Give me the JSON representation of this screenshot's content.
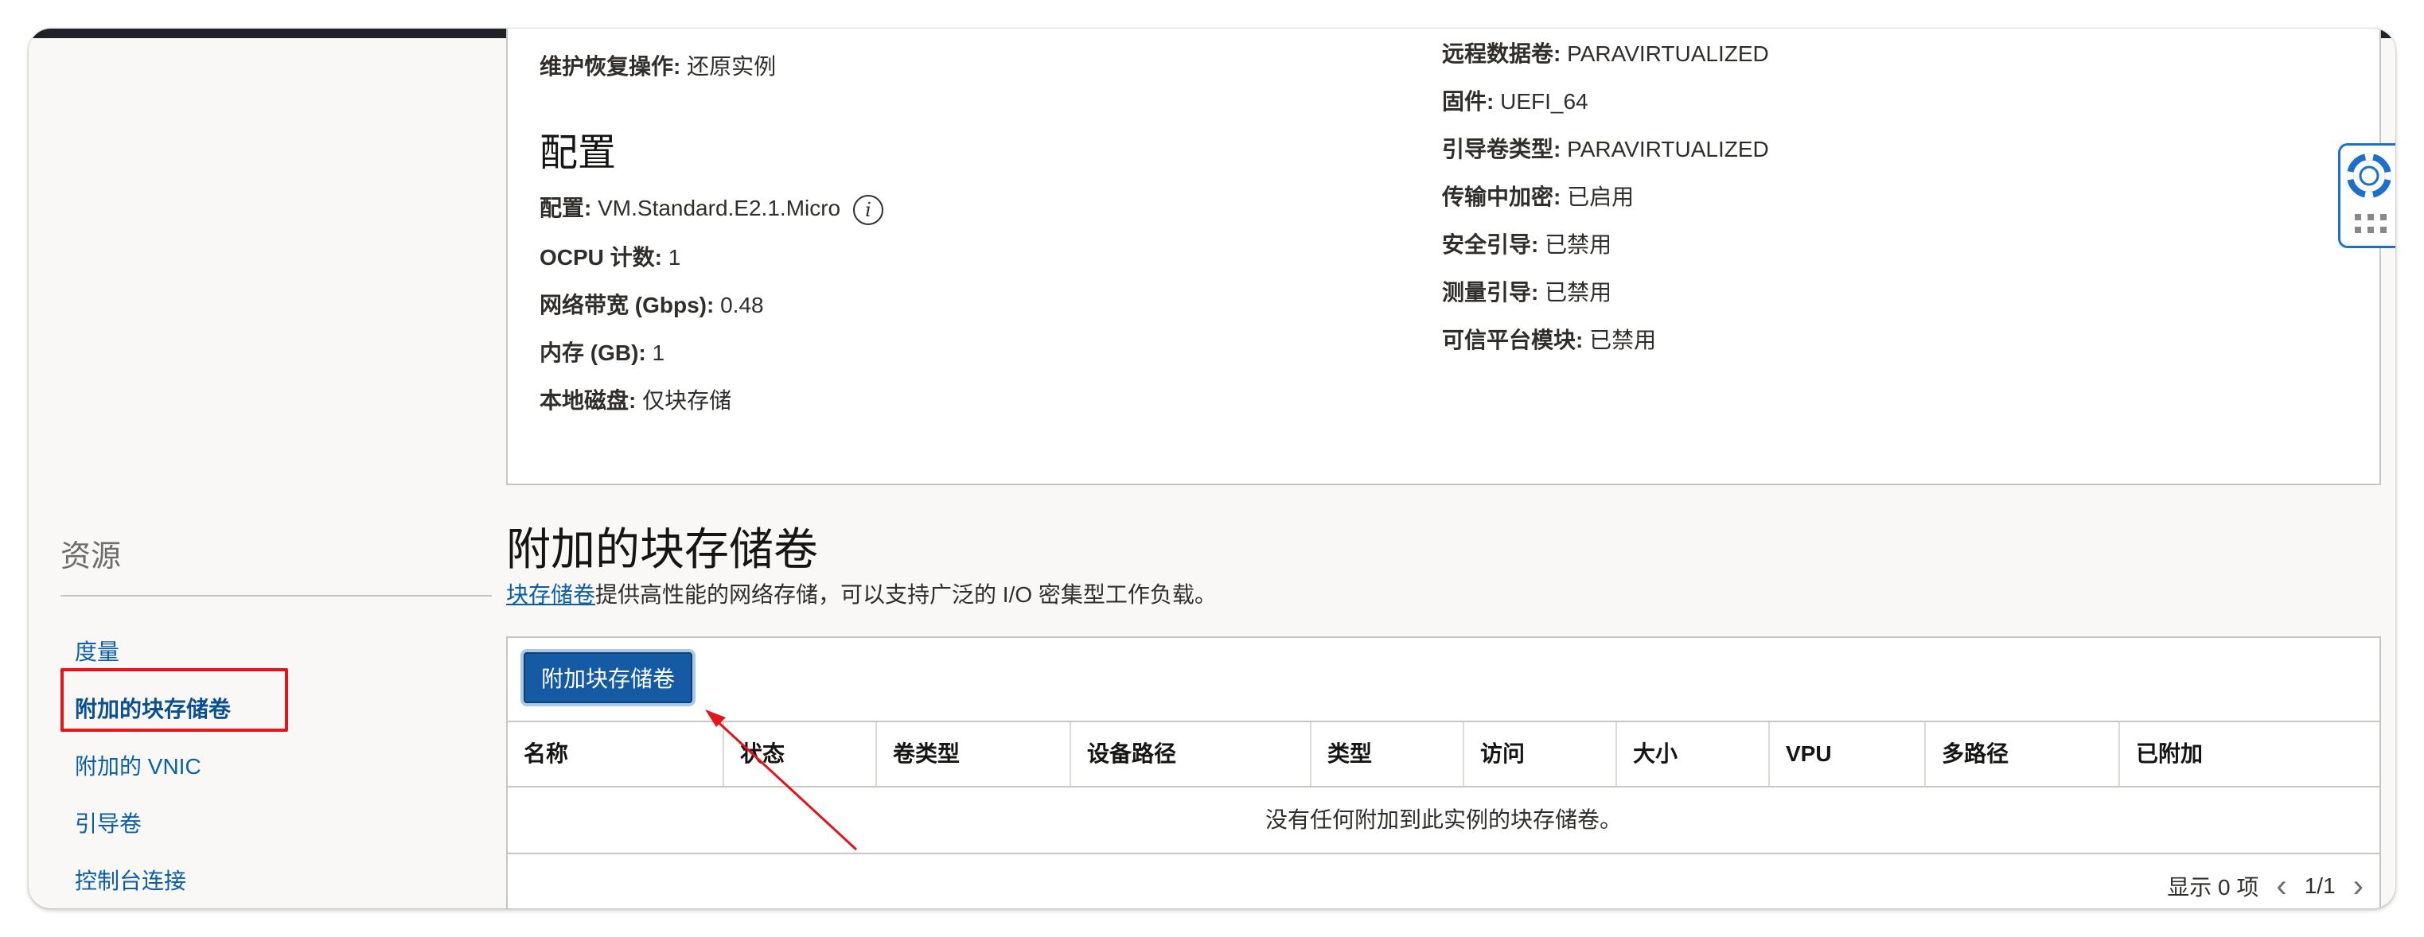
{
  "config_details": {
    "restore_action": {
      "key": "维护恢复操作:",
      "value": "还原实例"
    },
    "section_title": "配置",
    "shape": {
      "key": "配置:",
      "value": "VM.Standard.E2.1.Micro"
    },
    "ocpu": {
      "key": "OCPU 计数:",
      "value": "1"
    },
    "bandwidth": {
      "key": "网络带宽 (Gbps):",
      "value": "0.48"
    },
    "memory": {
      "key": "内存 (GB):",
      "value": "1"
    },
    "local_disk": {
      "key": "本地磁盘:",
      "value": "仅块存储"
    },
    "remote_data_volume": {
      "key": "远程数据卷:",
      "value": "PARAVIRTUALIZED"
    },
    "firmware": {
      "key": "固件:",
      "value": "UEFI_64"
    },
    "boot_volume_type": {
      "key": "引导卷类型:",
      "value": "PARAVIRTUALIZED"
    },
    "in_transit_encryption": {
      "key": "传输中加密:",
      "value": "已启用"
    },
    "secure_boot": {
      "key": "安全引导:",
      "value": "已禁用"
    },
    "measured_boot": {
      "key": "测量引导:",
      "value": "已禁用"
    },
    "trusted_platform_module": {
      "key": "可信平台模块:",
      "value": "已禁用"
    }
  },
  "sidebar": {
    "title": "资源",
    "items": [
      {
        "label": "度量"
      },
      {
        "label": "附加的块存储卷"
      },
      {
        "label": "附加的 VNIC"
      },
      {
        "label": "引导卷"
      },
      {
        "label": "控制台连接"
      }
    ]
  },
  "block_volumes": {
    "title": "附加的块存储卷",
    "desc_link": "块存储卷",
    "desc_text": "提供高性能的网络存储，可以支持广泛的 I/O 密集型工作负载。",
    "attach_button": "附加块存储卷",
    "columns": [
      "名称",
      "状态",
      "卷类型",
      "设备路径",
      "类型",
      "访问",
      "大小",
      "VPU",
      "多路径",
      "已附加"
    ],
    "empty_message": "没有任何附加到此实例的块存储卷。",
    "pager": {
      "count_label": "显示 0 项",
      "page": "1/1"
    }
  },
  "icons": {
    "info": "info-icon",
    "help": "lifebuoy-icon",
    "grip": "grip-dots-icon",
    "prev": "chevron-left-icon",
    "next": "chevron-right-icon"
  },
  "colors": {
    "link": "#0b5ea8",
    "primary_button": "#145ba4",
    "annotation_red": "#e3141c"
  }
}
